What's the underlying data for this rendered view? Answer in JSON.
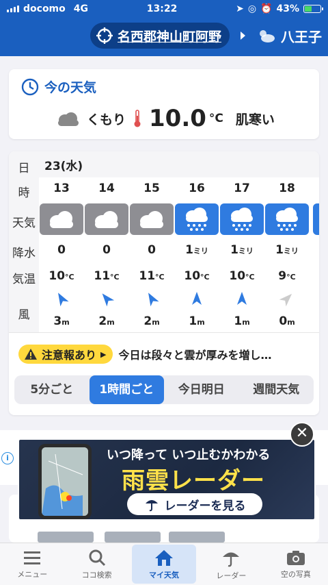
{
  "status": {
    "carrier": "docomo",
    "network": "4G",
    "time": "13:22",
    "battery": "43%"
  },
  "header": {
    "location": "名西郡神山町阿野",
    "next_location": "八王子"
  },
  "now": {
    "title": "今の天気",
    "condition": "くもり",
    "temp": "10.0",
    "unit": "°C",
    "feel": "肌寒い"
  },
  "forecast": {
    "labels": {
      "day": "日",
      "hour": "時",
      "weather": "天気",
      "rain": "降水",
      "temp": "気温",
      "wind": "風"
    },
    "date": "23(水)",
    "hours": [
      {
        "hour": "13",
        "weather": "cloudy",
        "rain": "0",
        "rain_unit": "",
        "temp": "10",
        "wind": "3",
        "wind_dir_deg": 330
      },
      {
        "hour": "14",
        "weather": "cloudy",
        "rain": "0",
        "rain_unit": "",
        "temp": "11",
        "wind": "2",
        "wind_dir_deg": 320
      },
      {
        "hour": "15",
        "weather": "cloudy",
        "rain": "0",
        "rain_unit": "",
        "temp": "11",
        "wind": "2",
        "wind_dir_deg": 330
      },
      {
        "hour": "16",
        "weather": "rain",
        "rain": "1",
        "rain_unit": "ミリ",
        "temp": "10",
        "wind": "1",
        "wind_dir_deg": 0
      },
      {
        "hour": "17",
        "weather": "rain",
        "rain": "1",
        "rain_unit": "ミリ",
        "temp": "10",
        "wind": "1",
        "wind_dir_deg": 0
      },
      {
        "hour": "18",
        "weather": "rain",
        "rain": "1",
        "rain_unit": "ミリ",
        "temp": "9",
        "wind": "0",
        "wind_dir_deg": 45
      }
    ],
    "temp_unit": "°C",
    "wind_unit": "m"
  },
  "alert": {
    "badge": "注意報あり",
    "text": "今日は段々と雲が厚みを増し…"
  },
  "segments": [
    "5分ごと",
    "1時間ごと",
    "今日明日",
    "週間天気"
  ],
  "ad": {
    "line1": "いつ降って いつ止むかわかる",
    "line2": "雨雲レーダー",
    "button": "レーダーを見る"
  },
  "tabs": [
    "メニュー",
    "ココ検索",
    "マイ天気",
    "レーダー",
    "空の写真"
  ],
  "colors": {
    "header": "#1a5fbf",
    "rain_bg": "#2f7be0",
    "cloud_bg": "#8e8e93",
    "alert": "#ffd83d"
  }
}
